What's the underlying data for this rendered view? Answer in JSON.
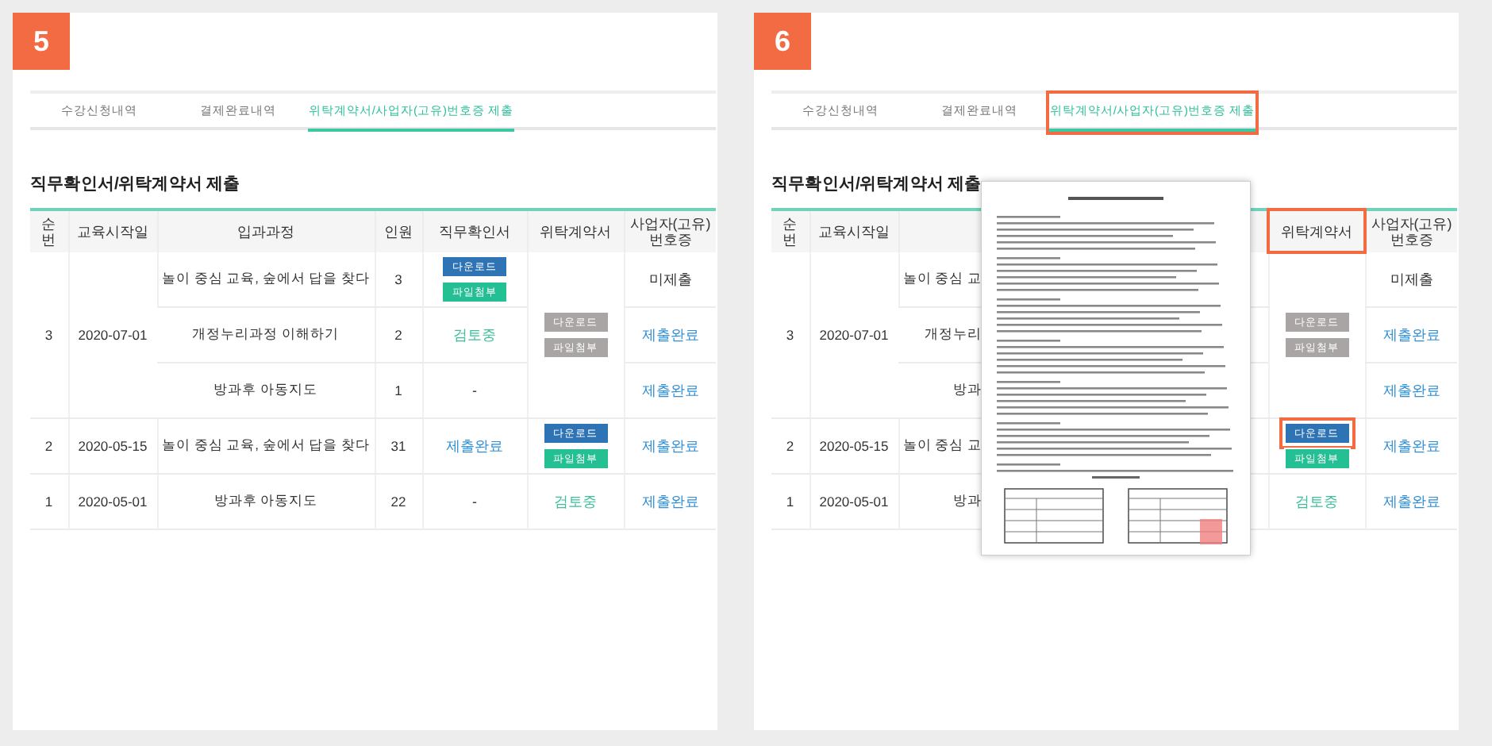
{
  "panels": [
    {
      "step": "5",
      "tabs": [
        {
          "label": "수강신청내역",
          "selected": false,
          "highlighted": false
        },
        {
          "label": "결제완료내역",
          "selected": false,
          "highlighted": false
        },
        {
          "label": "위탁계약서/사업자(고유)번호증 제출",
          "selected": true,
          "highlighted": false
        }
      ],
      "title": "직무확인서/위탁계약서 제출",
      "columns": [
        {
          "label": "순번",
          "highlighted": false
        },
        {
          "label": "교육시작일",
          "highlighted": false
        },
        {
          "label": "입과과정",
          "highlighted": false
        },
        {
          "label": "인원",
          "highlighted": false
        },
        {
          "label": "직무확인서",
          "highlighted": false
        },
        {
          "label": "위탁계약서",
          "highlighted": false
        },
        {
          "label": "사업자(고유) 번호증",
          "highlighted": false
        }
      ],
      "groups": [
        {
          "no": "3",
          "date": "2020-07-01",
          "contract": {
            "kind": "buttons",
            "buttons": [
              {
                "label": "다운로드",
                "kind": "download",
                "disabled": true,
                "highlighted": false
              },
              {
                "label": "파일첨부",
                "kind": "attach",
                "disabled": true,
                "highlighted": false
              }
            ]
          },
          "courses": [
            {
              "course": "놀이 중심 교육, 숲에서 답을 찾다",
              "headcount": "3",
              "duty": {
                "kind": "buttons",
                "buttons": [
                  {
                    "label": "다운로드",
                    "kind": "download",
                    "disabled": false,
                    "highlighted": false
                  },
                  {
                    "label": "파일첨부",
                    "kind": "attach",
                    "disabled": false,
                    "highlighted": false
                  }
                ]
              },
              "license": {
                "kind": "none",
                "text": "미제출"
              }
            },
            {
              "course": "개정누리과정 이해하기",
              "headcount": "2",
              "duty": {
                "kind": "review",
                "text": "검토중"
              },
              "license": {
                "kind": "done",
                "text": "제출완료"
              }
            },
            {
              "course": "방과후 아동지도",
              "headcount": "1",
              "duty": {
                "kind": "dash",
                "text": "-"
              },
              "license": {
                "kind": "done",
                "text": "제출완료"
              }
            }
          ]
        },
        {
          "no": "2",
          "date": "2020-05-15",
          "contract": {
            "kind": "buttons",
            "buttons": [
              {
                "label": "다운로드",
                "kind": "download",
                "disabled": false,
                "highlighted": false
              },
              {
                "label": "파일첨부",
                "kind": "attach",
                "disabled": false,
                "highlighted": false
              }
            ]
          },
          "courses": [
            {
              "course": "놀이 중심 교육, 숲에서 답을 찾다",
              "headcount": "31",
              "duty": {
                "kind": "done",
                "text": "제출완료"
              },
              "license": {
                "kind": "done",
                "text": "제출완료"
              }
            }
          ]
        },
        {
          "no": "1",
          "date": "2020-05-01",
          "contract": {
            "kind": "review",
            "text": "검토중"
          },
          "courses": [
            {
              "course": "방과후 아동지도",
              "headcount": "22",
              "duty": {
                "kind": "dash",
                "text": "-"
              },
              "license": {
                "kind": "done",
                "text": "제출완료"
              }
            }
          ]
        }
      ]
    },
    {
      "step": "6",
      "tabs": [
        {
          "label": "수강신청내역",
          "selected": false,
          "highlighted": false
        },
        {
          "label": "결제완료내역",
          "selected": false,
          "highlighted": false
        },
        {
          "label": "위탁계약서/사업자(고유)번호증 제출",
          "selected": true,
          "highlighted": true
        }
      ],
      "title": "직무확인서/위탁계약서 제출",
      "columns": [
        {
          "label": "순번",
          "highlighted": false
        },
        {
          "label": "교육시작일",
          "highlighted": false
        },
        {},
        {},
        {},
        {
          "label": "위탁계약서",
          "highlighted": true
        },
        {
          "label": "사업자(고유) 번호증",
          "highlighted": false
        }
      ],
      "groups": [
        {
          "no": "3",
          "date": "2020-07-01",
          "contract": {
            "kind": "buttons",
            "buttons": [
              {
                "label": "다운로드",
                "kind": "download",
                "disabled": true,
                "highlighted": false
              },
              {
                "label": "파일첨부",
                "kind": "attach",
                "disabled": true,
                "highlighted": false
              }
            ]
          },
          "courses": [
            {
              "course": "놀이 중심 교",
              "license": {
                "kind": "none",
                "text": "미제출"
              }
            },
            {
              "course": "개정누리",
              "license": {
                "kind": "done",
                "text": "제출완료"
              }
            },
            {
              "course": "방과",
              "license": {
                "kind": "done",
                "text": "제출완료"
              }
            }
          ]
        },
        {
          "no": "2",
          "date": "2020-05-15",
          "contract": {
            "kind": "buttons",
            "buttons": [
              {
                "label": "다운로드",
                "kind": "download",
                "disabled": false,
                "highlighted": true
              },
              {
                "label": "파일첨부",
                "kind": "attach",
                "disabled": false,
                "highlighted": false
              }
            ]
          },
          "courses": [
            {
              "course": "놀이 중심 교",
              "license": {
                "kind": "done",
                "text": "제출완료"
              }
            }
          ]
        },
        {
          "no": "1",
          "date": "2020-05-01",
          "contract": {
            "kind": "review",
            "text": "검토중"
          },
          "courses": [
            {
              "course": "방과",
              "license": {
                "kind": "done",
                "text": "제출완료"
              }
            }
          ]
        }
      ]
    }
  ]
}
